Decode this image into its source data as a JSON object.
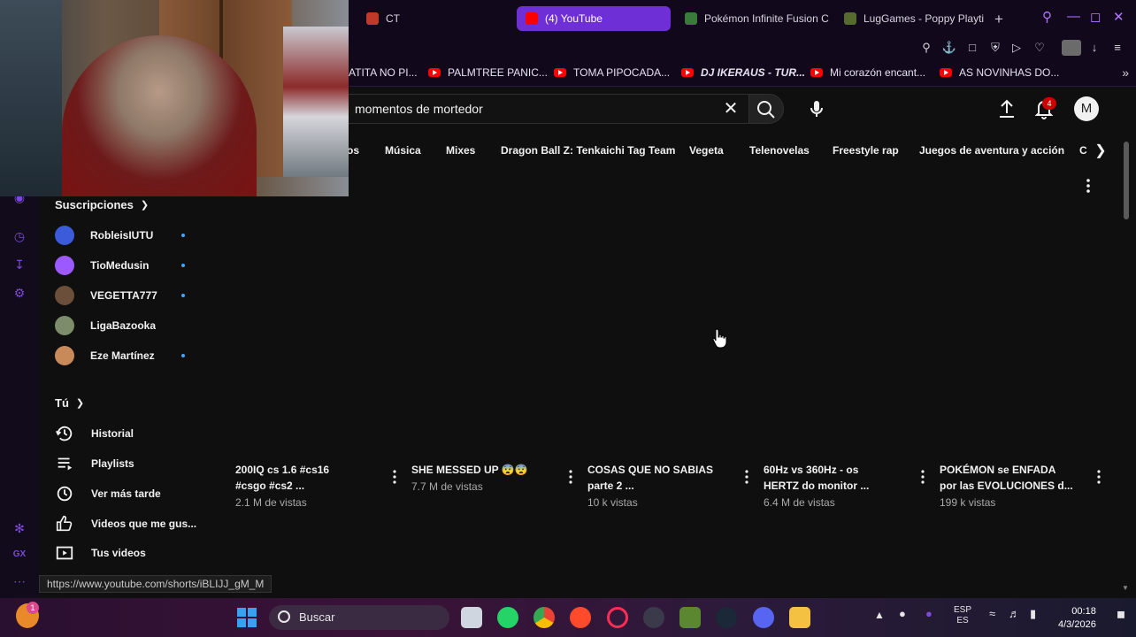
{
  "browser": {
    "tabs": [
      {
        "label": "CT",
        "color": "#c0392b"
      },
      {
        "label": "(4) YouTube",
        "color": "#ff0000",
        "active": true
      },
      {
        "label": "Pokémon Infinite Fusion C",
        "color": "#3a7a3a"
      },
      {
        "label": "LugGames - Poppy Playti",
        "color": "#556b2f"
      }
    ],
    "bookmarks": [
      "ATITA NO PI...",
      "PALMTREE PANIC...",
      "TOMA PIPOCADA...",
      "DJ IKERAUS - TUR...",
      "Mi corazón encant...",
      "AS NOVINHAS DO..."
    ]
  },
  "youtube": {
    "search": {
      "value": "momentos de mortedor"
    },
    "notifications": "4",
    "avatar_letter": "M",
    "chips": [
      "os",
      "Música",
      "Mixes",
      "Dragon Ball Z: Tenkaichi Tag Team",
      "Vegeta",
      "Telenovelas",
      "Freestyle rap",
      "Juegos de aventura y acción",
      "C"
    ],
    "sidebar": {
      "subscriptions_title": "Suscripciones",
      "subscriptions": [
        {
          "name": "RobleisIUTU",
          "color": "#3b5bdb"
        },
        {
          "name": "TioMedusin",
          "color": "#9b59ff"
        },
        {
          "name": "VEGETTA777",
          "color": "#6b4f3a"
        },
        {
          "name": "LigaBazooka",
          "color": "#7d8c6a"
        },
        {
          "name": "Eze Martínez",
          "color": "#c98a5a"
        }
      ],
      "you_title": "Tú",
      "you_items": [
        {
          "label": "Historial",
          "icon": "history-icon"
        },
        {
          "label": "Playlists",
          "icon": "playlist-icon"
        },
        {
          "label": "Ver más tarde",
          "icon": "clock-icon"
        },
        {
          "label": "Videos que me gus...",
          "icon": "thumbs-up-icon"
        },
        {
          "label": "Tus videos",
          "icon": "video-icon"
        }
      ]
    },
    "shorts": [
      {
        "title": "200IQ cs 1.6 #cs16\n#csgo #cs2 ...",
        "views": "2.1 M de vistas"
      },
      {
        "title": "SHE MESSED UP 😨😨",
        "views": "7.7 M de vistas"
      },
      {
        "title": "COSAS QUE NO SABIAS\nparte 2 ...",
        "views": "10 k vistas"
      },
      {
        "title": "60Hz vs 360Hz - os\nHERTZ do monitor ...",
        "views": "6.4 M de vistas"
      },
      {
        "title": "POKÉMON se ENFADA\npor las EVOLUCIONES d...",
        "views": "199 k vistas"
      }
    ],
    "status_url": "https://www.youtube.com/shorts/iBLIJJ_gM_M"
  },
  "taskbar": {
    "search_label": "Buscar",
    "lang_top": "ESP",
    "lang_bottom": "ES",
    "time": "00:18",
    "date": "4/3/2026",
    "notification_badge": "1"
  }
}
